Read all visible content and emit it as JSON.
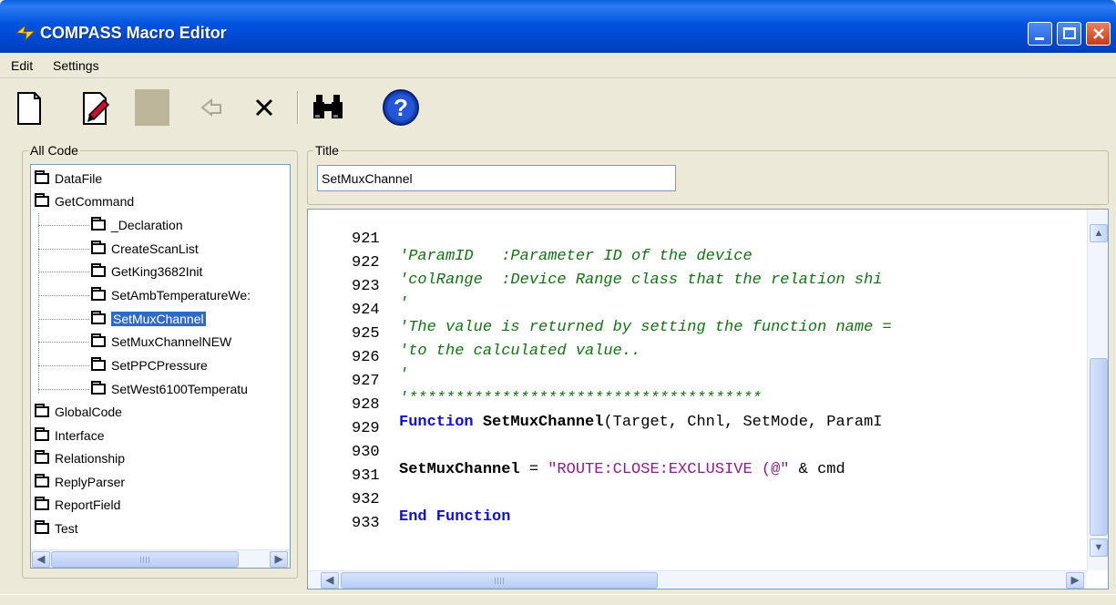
{
  "window": {
    "title": "COMPASS Macro Editor"
  },
  "menu": {
    "edit": "Edit",
    "settings": "Settings"
  },
  "tree_panel": {
    "label": "All Code",
    "items": [
      {
        "label": "DataFile",
        "level": 0
      },
      {
        "label": "GetCommand",
        "level": 0
      },
      {
        "label": "_Declaration",
        "level": 1
      },
      {
        "label": "CreateScanList",
        "level": 1
      },
      {
        "label": "GetKing3682Init",
        "level": 1
      },
      {
        "label": "SetAmbTemperatureWe:",
        "level": 1
      },
      {
        "label": "SetMuxChannel",
        "level": 1,
        "selected": true
      },
      {
        "label": "SetMuxChannelNEW",
        "level": 1
      },
      {
        "label": "SetPPCPressure",
        "level": 1
      },
      {
        "label": "SetWest6100Temperatu",
        "level": 1
      },
      {
        "label": "GlobalCode",
        "level": 0
      },
      {
        "label": "Interface",
        "level": 0
      },
      {
        "label": "Relationship",
        "level": 0
      },
      {
        "label": "ReplyParser",
        "level": 0
      },
      {
        "label": "ReportField",
        "level": 0
      },
      {
        "label": "Test",
        "level": 0
      }
    ]
  },
  "title_panel": {
    "label": "Title",
    "value": "SetMuxChannel"
  },
  "editor": {
    "lines": [
      {
        "num": "921",
        "text": "'ParamID   :Parameter ID of the device",
        "type": "comment"
      },
      {
        "num": "922",
        "text": "'colRange  :Device Range class that the relation shi",
        "type": "comment"
      },
      {
        "num": "923",
        "text": "'",
        "type": "comment"
      },
      {
        "num": "924",
        "text": "'The value is returned by setting the function name =",
        "type": "comment"
      },
      {
        "num": "925",
        "text": "'to the calculated value..",
        "type": "comment"
      },
      {
        "num": "926",
        "text": "'",
        "type": "comment"
      },
      {
        "num": "927",
        "text": "'**************************************",
        "type": "comment"
      },
      {
        "num": "928",
        "kw": "Function ",
        "fn": "SetMuxChannel",
        "rest": "(Target, Chnl, SetMode, ParamI",
        "type": "function"
      },
      {
        "num": "929",
        "text": "",
        "type": "plain"
      },
      {
        "num": "930",
        "fn": "SetMuxChannel",
        "op": " = ",
        "str": "\"ROUTE:CLOSE:EXCLUSIVE (@\"",
        "rest": " & cmd",
        "type": "assign"
      },
      {
        "num": "931",
        "text": "",
        "type": "plain"
      },
      {
        "num": "932",
        "kw": "End Function",
        "type": "keyword"
      },
      {
        "num": "933",
        "text": "",
        "type": "plain"
      }
    ]
  },
  "icons": {
    "new": "new-document-icon",
    "edit": "edit-document-icon",
    "blank": "disabled-icon",
    "undo": "undo-icon",
    "delete": "delete-icon",
    "find": "binoculars-icon",
    "help": "help-icon"
  },
  "colors": {
    "titlebar": "#0053e0",
    "comment": "#157015",
    "keyword": "#1010d0",
    "string": "#8b1c8b",
    "selection": "#316ac5"
  }
}
